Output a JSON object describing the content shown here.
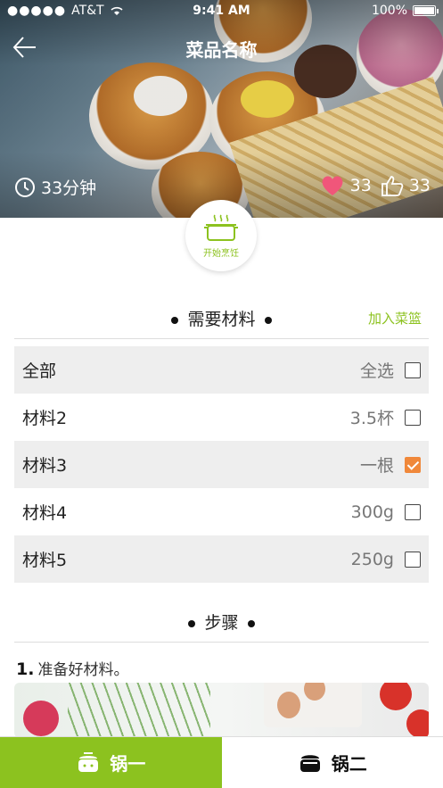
{
  "status_bar": {
    "carrier": "AT&T",
    "time": "9:41 AM",
    "battery": "100%"
  },
  "nav": {
    "title": "菜品名称"
  },
  "hero": {
    "cook_time": "33分钟",
    "likes": "33",
    "thumbs": "33"
  },
  "cook_button": {
    "label": "开始烹饪"
  },
  "ingredients": {
    "heading": "需要材料",
    "add_to_basket": "加入菜篮",
    "rows": [
      {
        "name": "全部",
        "amount": "全选",
        "checked": false
      },
      {
        "name": "材料2",
        "amount": "3.5杯",
        "checked": false
      },
      {
        "name": "材料3",
        "amount": "一根",
        "checked": true
      },
      {
        "name": "材料4",
        "amount": "300g",
        "checked": false
      },
      {
        "name": "材料5",
        "amount": "250g",
        "checked": false
      }
    ]
  },
  "steps": {
    "heading": "步骤",
    "items": [
      {
        "number": "1.",
        "text": "准备好材料。"
      }
    ]
  },
  "tabs": [
    {
      "label": "锅一",
      "active": true
    },
    {
      "label": "锅二",
      "active": false
    }
  ],
  "colors": {
    "accent_green": "#8cc21f",
    "check_orange": "#f0883a",
    "heart_pink": "#f0567a"
  }
}
